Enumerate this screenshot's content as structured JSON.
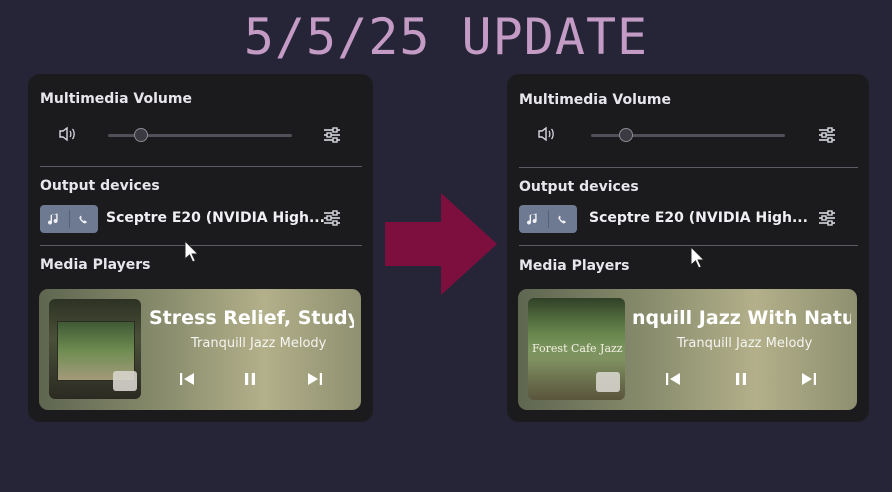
{
  "header": {
    "title": "5/5/25 UPDATE"
  },
  "icons": {
    "volume": "volume-icon",
    "equalizer": "equalizer-icon",
    "music_note": "music-note-icon",
    "phone": "phone-icon",
    "previous": "skip-previous-icon",
    "pause": "pause-icon",
    "next": "skip-next-icon",
    "arrow": "right-arrow-icon",
    "cursor": "mouse-cursor-icon"
  },
  "colors": {
    "accent_title": "#c39bc4",
    "arrow": "#7d0f3e",
    "device_toggle": "#6d7a92"
  },
  "panels": [
    {
      "volume": {
        "label": "Multimedia Volume",
        "level": 0.18
      },
      "output": {
        "label": "Output devices",
        "device_name": "Sceptre E20 (NVIDIA High..."
      },
      "media": {
        "label": "Media Players",
        "track_title": "Stress Relief, Study & Wo",
        "artist": "Tranquill Jazz Melody"
      }
    },
    {
      "volume": {
        "label": "Multimedia Volume",
        "level": 0.18
      },
      "output": {
        "label": "Output devices",
        "device_name": "Sceptre E20 (NVIDIA High..."
      },
      "media": {
        "label": "Media Players",
        "track_title": "nquill Jazz With Nature T",
        "artist": "Tranquill Jazz Melody",
        "cover_text": "Forest Cafe Jazz"
      }
    }
  ]
}
